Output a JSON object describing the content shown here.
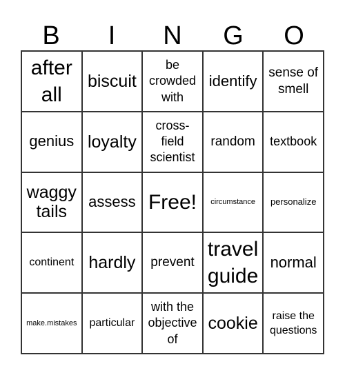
{
  "header": [
    "B",
    "I",
    "N",
    "G",
    "O"
  ],
  "cells": [
    [
      "after all",
      "biscuit",
      "be crowded with",
      "identify",
      "sense of smell"
    ],
    [
      "genius",
      "loyalty",
      "cross-field scientist",
      "random",
      "textbook"
    ],
    [
      "waggy tails",
      "assess",
      "Free!",
      "circumstance",
      "personalize"
    ],
    [
      "continent",
      "hardly",
      "prevent",
      "travel guide",
      "normal"
    ],
    [
      "make.mistakes",
      "particular",
      "with the objective of",
      "cookie",
      "raise the questions"
    ]
  ]
}
